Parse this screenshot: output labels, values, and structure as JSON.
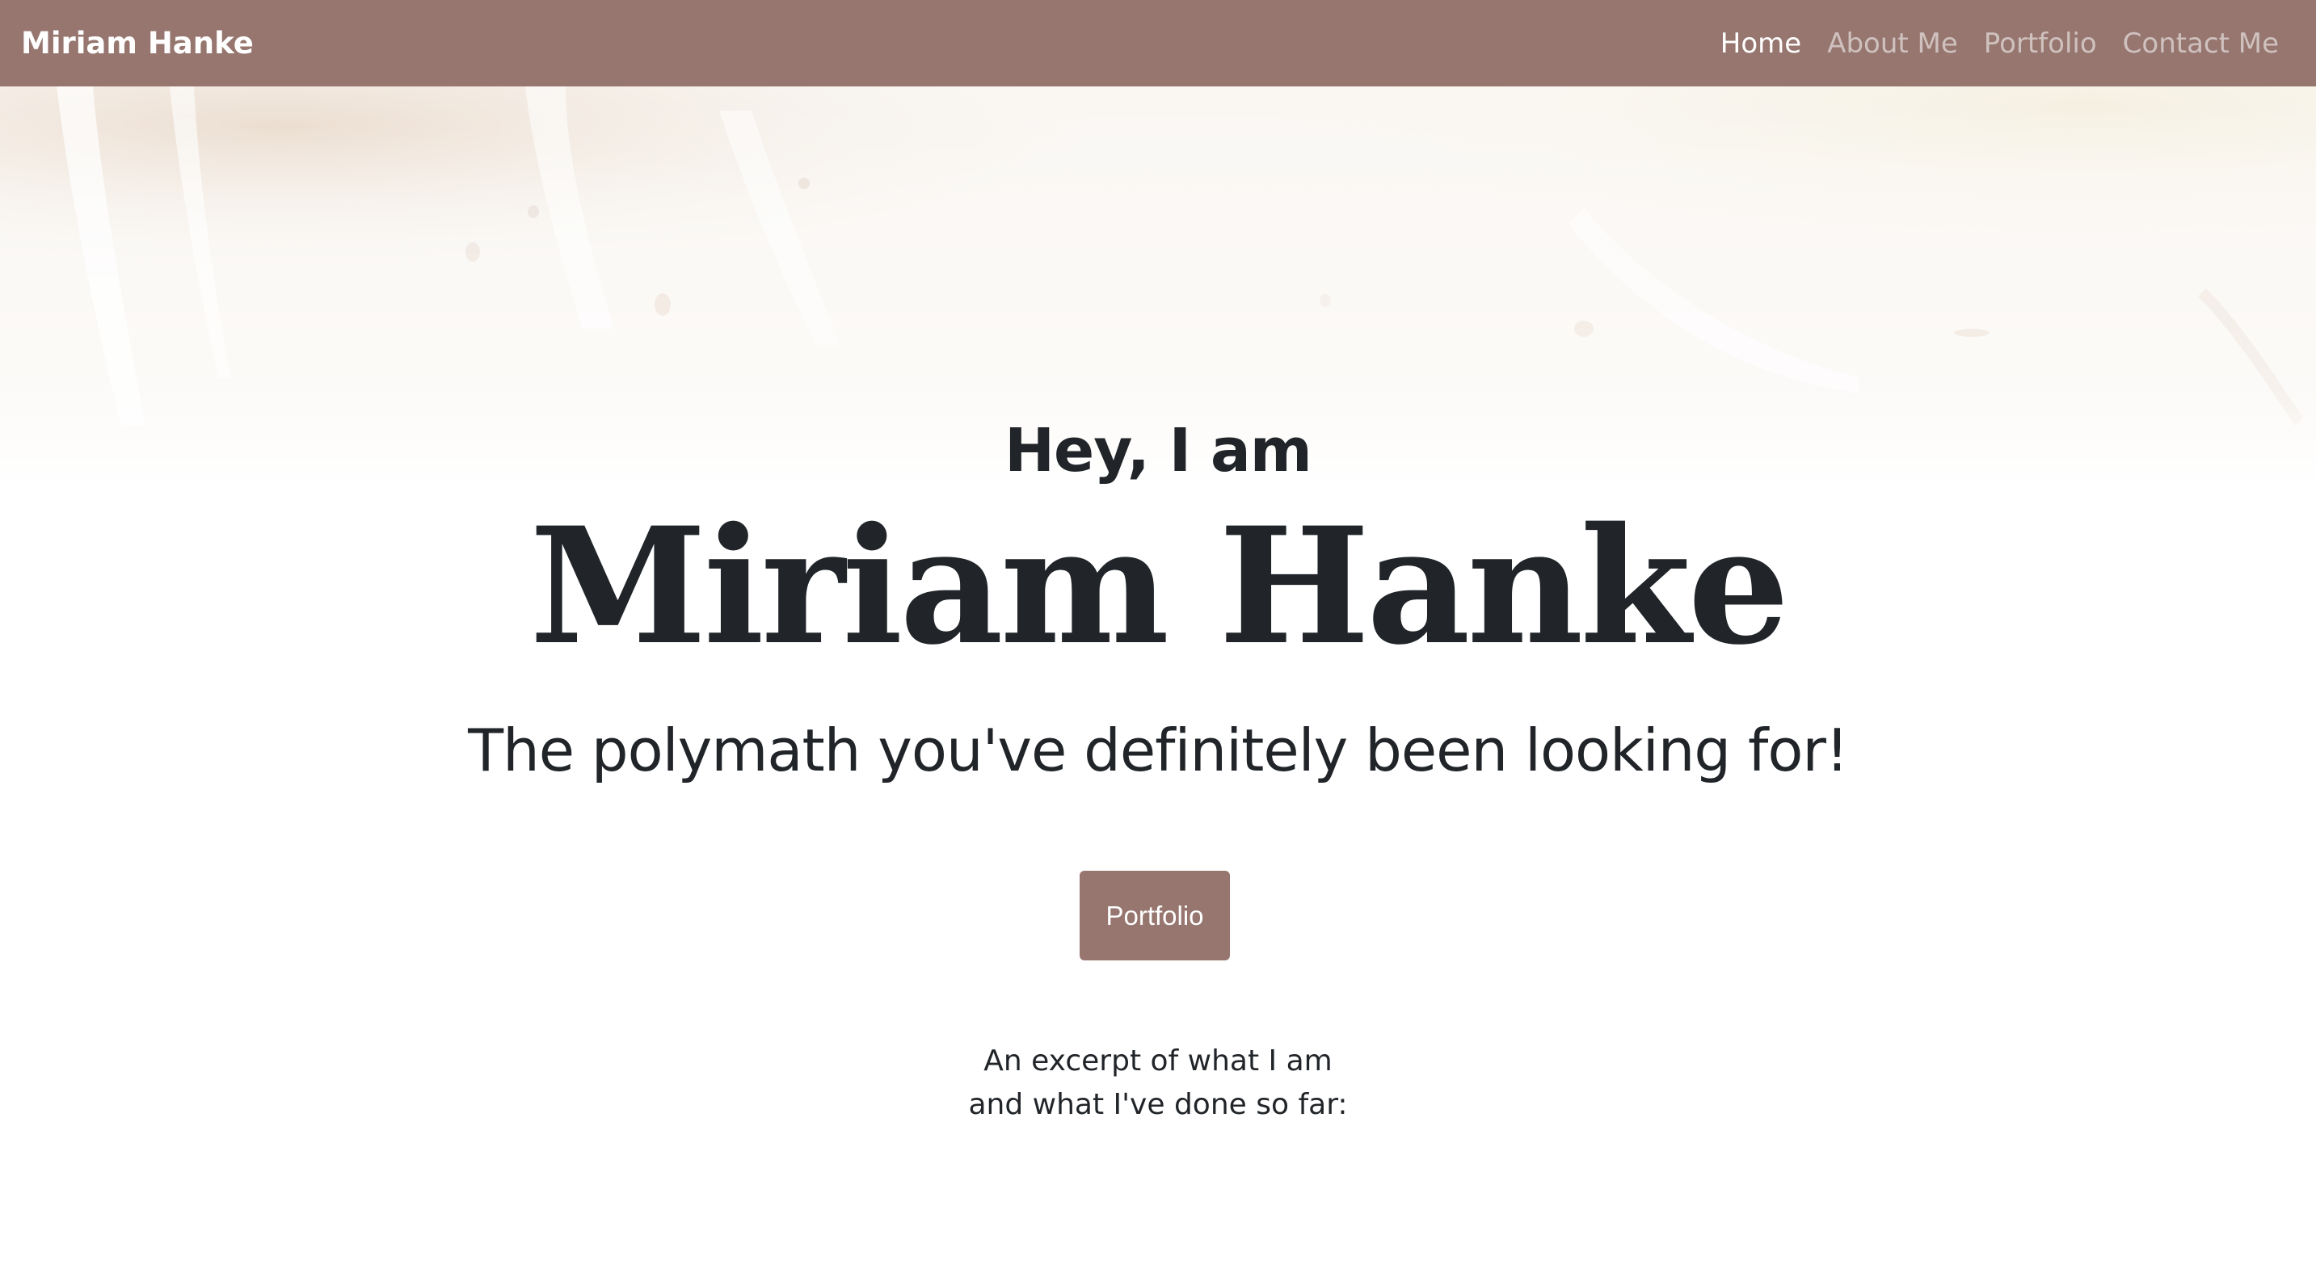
{
  "nav": {
    "brand": "Miriam Hanke",
    "links": [
      {
        "label": "Home",
        "active": true
      },
      {
        "label": "About Me",
        "active": false
      },
      {
        "label": "Portfolio",
        "active": false
      },
      {
        "label": "Contact Me",
        "active": false
      }
    ]
  },
  "hero": {
    "greeting": "Hey, I am",
    "name": "Miriam Hanke",
    "tagline": "The polymath you've definitely been looking for!",
    "cta_label": "Portfolio",
    "excerpt_line1": "An excerpt of what I am",
    "excerpt_line2": "and what I've done so far:"
  },
  "colors": {
    "accent": "#96766f",
    "text": "#212529",
    "nav_text_inactive": "rgba(255,255,255,0.55)"
  }
}
